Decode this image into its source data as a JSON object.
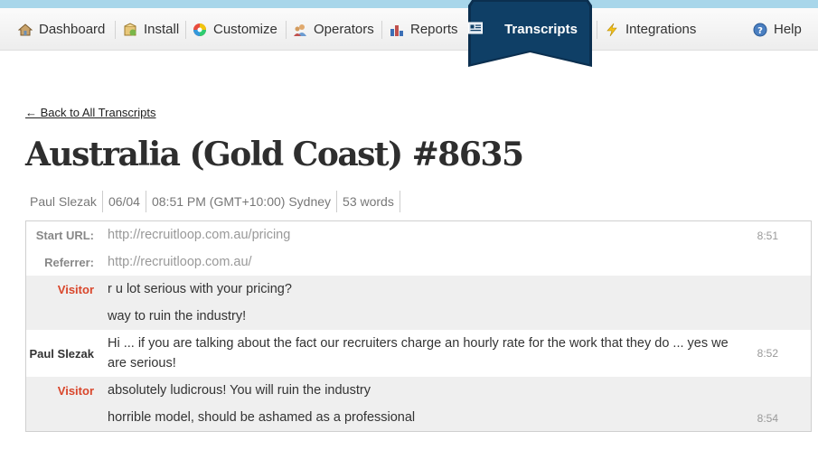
{
  "nav": {
    "items": [
      {
        "label": "Dashboard",
        "icon": "house-icon"
      },
      {
        "label": "Install",
        "icon": "package-icon"
      },
      {
        "label": "Customize",
        "icon": "color-wheel-icon"
      },
      {
        "label": "Operators",
        "icon": "users-icon"
      },
      {
        "label": "Reports",
        "icon": "bar-chart-icon"
      },
      {
        "label": "Transcripts",
        "icon": "transcript-icon",
        "active": true
      },
      {
        "label": "Integrations",
        "icon": "lightning-icon"
      },
      {
        "label": "Help",
        "icon": "help-icon"
      }
    ],
    "active_color": "#0d3a5f",
    "strip_color": "#a8d6ea"
  },
  "back_link": "← Back to All Transcripts",
  "title": "Australia (Gold Coast) #8635",
  "meta": {
    "operator": "Paul Slezak",
    "date": "06/04",
    "time": "08:51 PM (GMT+10:00) Sydney",
    "words": "53 words"
  },
  "transcript": {
    "start_url": {
      "label": "Start URL:",
      "value": "http://recruitloop.com.au/pricing",
      "time": "8:51"
    },
    "referrer": {
      "label": "Referrer:",
      "value": "http://recruitloop.com.au/"
    },
    "messages": [
      {
        "speaker": "Visitor",
        "text": "r u lot serious with your pricing?",
        "time": ""
      },
      {
        "speaker": "",
        "text": "way to ruin the industry!",
        "time": ""
      },
      {
        "speaker": "Paul Slezak",
        "text": "Hi ... if you are talking about the fact our recruiters charge an hourly rate for the work that they do ... yes we are serious!",
        "time": "8:52"
      },
      {
        "speaker": "Visitor",
        "text": "absolutely ludicrous! You will ruin the industry",
        "time": ""
      },
      {
        "speaker": "",
        "text": "horrible model, should be ashamed as a professional",
        "time": "8:54"
      }
    ],
    "visitor_color": "#d9462b"
  }
}
